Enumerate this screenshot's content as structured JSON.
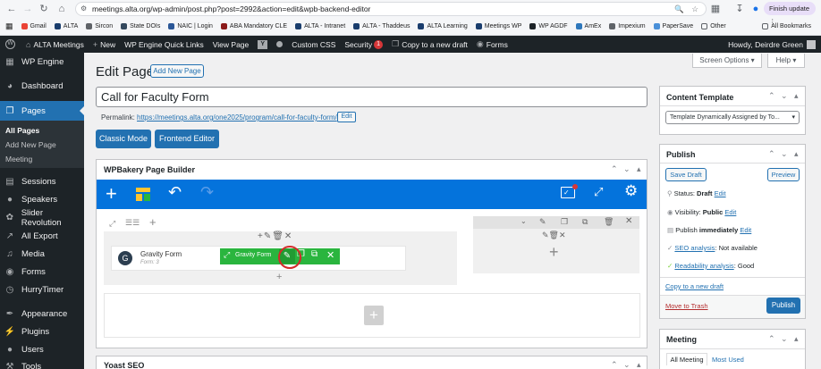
{
  "browser": {
    "url": "meetings.alta.org/wp-admin/post.php?post=2992&action=edit&wpb-backend-editor",
    "finish_update": "Finish update",
    "bookmarks": [
      "Gmail",
      "ALTA",
      "Sircon",
      "State DOIs",
      "NAIC | Login",
      "ABA Mandatory CLE",
      "ALTA - Intranet",
      "ALTA - Thaddeus",
      "ALTA Learning",
      "Meetings WP",
      "WP AGDF",
      "AmEx",
      "Impexium",
      "PaperSave",
      "Other"
    ],
    "all_bookmarks": "All Bookmarks"
  },
  "adminbar": {
    "site": "ALTA Meetings",
    "new": "New",
    "quick_links": "WP Engine Quick Links",
    "view_page": "View Page",
    "custom_css": "Custom CSS",
    "security": "Security",
    "security_count": "1",
    "copy_draft": "Copy to a new draft",
    "forms": "Forms",
    "howdy": "Howdy, Deirdre Green"
  },
  "sidebar": {
    "items": [
      "WP Engine",
      "Dashboard",
      "Pages",
      "Sessions",
      "Speakers",
      "Slider Revolution",
      "All Export",
      "Media",
      "Forms",
      "HurryTimer",
      "Appearance",
      "Plugins",
      "Users",
      "Tools"
    ],
    "subitems": [
      "All Pages",
      "Add New Page",
      "Meeting"
    ]
  },
  "page": {
    "heading": "Edit Page",
    "add_new": "Add New Page",
    "screen_options": "Screen Options",
    "help": "Help",
    "title_value": "Call for Faculty Form",
    "permalink_label": "Permalink:",
    "permalink_base": "https://meetings.alta.org/one2025/program/",
    "permalink_slug": "call-for-faculty",
    "permalink_end": "form/",
    "edit": "Edit",
    "classic_mode": "Classic Mode",
    "frontend_editor": "Frontend Editor"
  },
  "wpb": {
    "title": "WPBakery Page Builder",
    "element_name": "Gravity Form",
    "element_sub": "Form: 3",
    "toolbar_label": "Gravity Form"
  },
  "yoast": {
    "title": "Yoast SEO"
  },
  "template": {
    "title": "Content Template",
    "select_value": "Template Dynamically Assigned by To..."
  },
  "publish": {
    "title": "Publish",
    "save_draft": "Save Draft",
    "preview": "Preview",
    "status_label": "Status:",
    "status_value": "Draft",
    "visibility_label": "Visibility:",
    "visibility_value": "Public",
    "publish_label": "Publish",
    "publish_value": "immediately",
    "seo_label": "SEO analysis",
    "seo_value": ": Not available",
    "read_label": "Readability analysis",
    "read_value": ": Good",
    "copy_draft": "Copy to a new draft",
    "trash": "Move to Trash",
    "publish_btn": "Publish",
    "edit": "Edit"
  },
  "meeting": {
    "title": "Meeting",
    "tab_all": "All Meeting",
    "tab_used": "Most Used"
  },
  "colors": {
    "wp_blue": "#2271b1",
    "wpb_blue": "#0473dc",
    "wpb_green": "#2ab53e",
    "highlight": "#d42a2a"
  }
}
